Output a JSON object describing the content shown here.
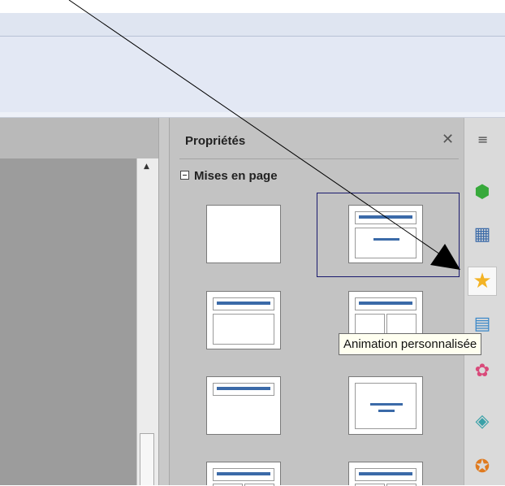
{
  "sidebar": {
    "panel_title": "Propriétés",
    "close_glyph": "✕",
    "sections": [
      {
        "label": "Mises en page",
        "collapsed": false
      }
    ],
    "layouts": [
      {
        "name": "blank",
        "selected": false
      },
      {
        "name": "title-content",
        "selected": true
      },
      {
        "name": "title-content",
        "selected": false
      },
      {
        "name": "title-2-content",
        "selected": false
      },
      {
        "name": "title-only",
        "selected": false
      },
      {
        "name": "centered-text",
        "selected": false
      },
      {
        "name": "title-2-content-partial",
        "selected": false
      },
      {
        "name": "title-content-partial",
        "selected": false
      }
    ]
  },
  "tabbar": {
    "menu_glyph": "≡",
    "tabs": [
      {
        "icon": "cube-icon",
        "glyph": "⬢",
        "color": "#37a93b",
        "active": false
      },
      {
        "icon": "master-slides-icon",
        "glyph": "▦",
        "color": "#3b6aa8",
        "active": false
      },
      {
        "icon": "star-icon",
        "glyph": "★",
        "color": "#f3b325",
        "active": true
      },
      {
        "icon": "slide-transition-icon",
        "glyph": "▤",
        "color": "#3b88c8",
        "active": false
      },
      {
        "icon": "gallery-icon",
        "glyph": "✿",
        "color": "#d94a7a",
        "active": false
      },
      {
        "icon": "navigator-image-icon",
        "glyph": "◈",
        "color": "#3aa1a8",
        "active": false
      },
      {
        "icon": "compass-icon",
        "glyph": "✪",
        "color": "#e07a1e",
        "active": false
      }
    ]
  },
  "tooltip": {
    "text": "Animation personnalisée"
  },
  "colors": {
    "accent_bar": "#3b6aa8",
    "selection": "#1a1a6e",
    "tooltip_bg": "#fffff0"
  }
}
